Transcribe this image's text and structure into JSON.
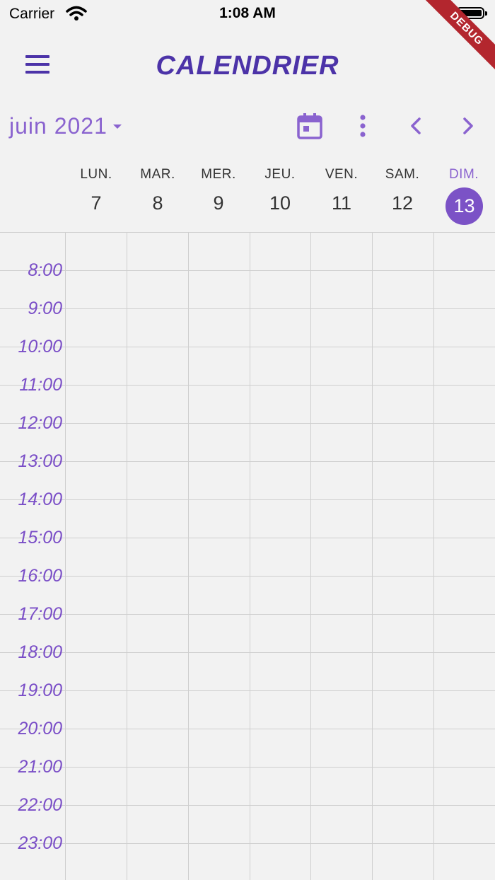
{
  "status": {
    "carrier": "Carrier",
    "time": "1:08 AM"
  },
  "debug_banner": "DEBUG",
  "app": {
    "title": "CALENDRIER"
  },
  "toolbar": {
    "month_label": "juin 2021",
    "icons": [
      "calendar-today-icon",
      "more-vert-icon",
      "chevron-left-icon",
      "chevron-right-icon"
    ],
    "accent": "#8a63cf"
  },
  "week": {
    "days": [
      {
        "name": "LUN.",
        "num": "7"
      },
      {
        "name": "MAR.",
        "num": "8"
      },
      {
        "name": "MER.",
        "num": "9"
      },
      {
        "name": "JEU.",
        "num": "10"
      },
      {
        "name": "VEN.",
        "num": "11"
      },
      {
        "name": "SAM.",
        "num": "12"
      },
      {
        "name": "DIM.",
        "num": "13"
      }
    ],
    "selected": "13",
    "selected_color": "#7b52c6"
  },
  "hours": [
    "8:00",
    "9:00",
    "10:00",
    "11:00",
    "12:00",
    "13:00",
    "14:00",
    "15:00",
    "16:00",
    "17:00",
    "18:00",
    "19:00",
    "20:00",
    "21:00",
    "22:00",
    "23:00"
  ]
}
